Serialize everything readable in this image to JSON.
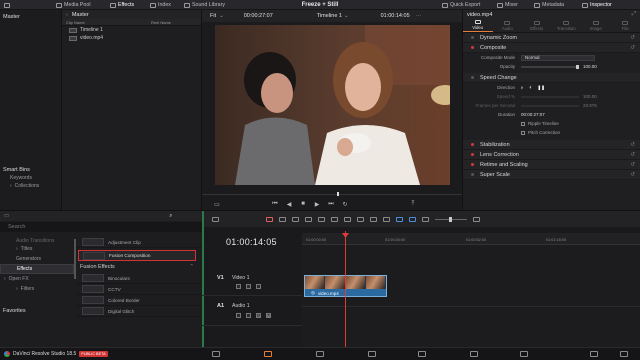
{
  "topbar": {
    "media_pool": "Media Pool",
    "effects": "Effects",
    "index": "Index",
    "sound_library": "Sound Library",
    "title": "Freeze + Still",
    "quick_export": "Quick Export",
    "mixer": "Mixer",
    "metadata": "Metadata",
    "inspector": "Inspector"
  },
  "media_pool": {
    "bin_header": "Master",
    "master_bin": "Master",
    "col_clip_name": "Clip Name",
    "col_reel_name": "Reel Name",
    "clips": [
      "Timeline 1",
      "video.mp4"
    ],
    "smart_bins": "Smart Bins",
    "keywords": "Keywords",
    "collections": "Collections"
  },
  "viewer": {
    "fit": "Fit",
    "source_timecode": "00:00:27:07",
    "timeline_name": "Timeline 1",
    "record_timecode": "01:00:14:05"
  },
  "inspector": {
    "clip_name": "video.mp4",
    "tabs": [
      "Video",
      "Audio",
      "Effects",
      "Transition",
      "Image",
      "File"
    ],
    "sections": {
      "dynamic_zoom": "Dynamic Zoom",
      "composite": "Composite",
      "speed_change": "Speed Change",
      "stabilization": "Stabilization",
      "lens_correction": "Lens Correction",
      "retime_scaling": "Retime and Scaling",
      "super_scale": "Super Scale"
    },
    "composite_mode_label": "Composite Mode",
    "composite_mode_value": "Normal",
    "opacity_label": "Opacity",
    "opacity_value": "100.00",
    "opacity_fraction": 1.0,
    "direction_label": "Direction",
    "speed_label": "Speed %",
    "speed_value": "100.00",
    "fps_label": "Frames per Second",
    "fps_value": "23.976",
    "duration_label": "Duration",
    "duration_value": "00:00:27:07",
    "ripple_timeline": "Ripple Timeline",
    "pitch_correction": "Pitch Correction"
  },
  "effects_library": {
    "search": "Search",
    "audio_transitions": "Audio Transitions",
    "titles": "Titles",
    "generators": "Generators",
    "effects": "Effects",
    "open_fx": "Open FX",
    "filters": "Filters",
    "favorites": "Favorites",
    "adjustment_clip": "Adjustment Clip",
    "fusion_composition": "Fusion Composition",
    "fusion_effects_header": "Fusion Effects",
    "fusion_effects": [
      "Binoculars",
      "CCTV",
      "Colored Border",
      "Digital Glitch"
    ]
  },
  "timeline": {
    "timecode": "01:00:14:05",
    "ruler": [
      "01:00:00:00",
      "01:00:26:00",
      "01:00:52:00",
      "01:01:18:00"
    ],
    "video_track_id": "V1",
    "video_track_name": "Video 1",
    "audio_track_id": "A1",
    "audio_track_name": "Audio 1",
    "clip_name": "video.mp4"
  },
  "bottombar": {
    "app": "DaVinci Resolve Studio 18.5",
    "badge": "PUBLIC BETA"
  },
  "colors": {
    "accent_orange": "#e4803a",
    "playhead_red": "#e03a3a",
    "clip_blue": "#3a7fb5",
    "selection_red": "#d13434"
  }
}
